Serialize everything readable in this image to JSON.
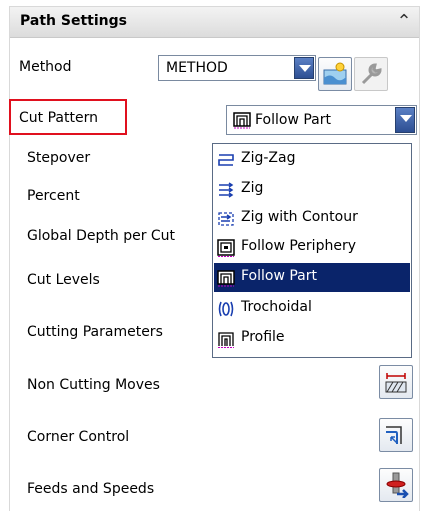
{
  "header": {
    "title": "Path Settings",
    "collapse_icon": "chevron-up-icon"
  },
  "method": {
    "label": "Method",
    "value": "METHOD"
  },
  "cut_pattern": {
    "label": "Cut Pattern",
    "value": "Follow Part",
    "highlight_color": "#e0101e"
  },
  "rows": {
    "stepover": "Stepover",
    "percent": "Percent",
    "global_depth": "Global Depth per Cut",
    "cut_levels": "Cut Levels",
    "cutting_parameters": "Cutting Parameters",
    "non_cutting_moves": "Non Cutting Moves",
    "corner_control": "Corner Control",
    "feeds_and_speeds": "Feeds and Speeds"
  },
  "dropdown": {
    "items": [
      {
        "label": "Zig-Zag",
        "icon": "zigzag-pattern-icon",
        "selected": false
      },
      {
        "label": "Zig",
        "icon": "zig-pattern-icon",
        "selected": false
      },
      {
        "label": "Zig with Contour",
        "icon": "zig-with-contour-icon",
        "selected": false
      },
      {
        "label": "Follow Periphery",
        "icon": "follow-periphery-icon",
        "selected": false
      },
      {
        "label": "Follow Part",
        "icon": "follow-part-icon",
        "selected": true
      },
      {
        "label": "Trochoidal",
        "icon": "trochoidal-icon",
        "selected": false
      },
      {
        "label": "Profile",
        "icon": "profile-icon",
        "selected": false
      }
    ],
    "selected_color": "#0a246a"
  }
}
